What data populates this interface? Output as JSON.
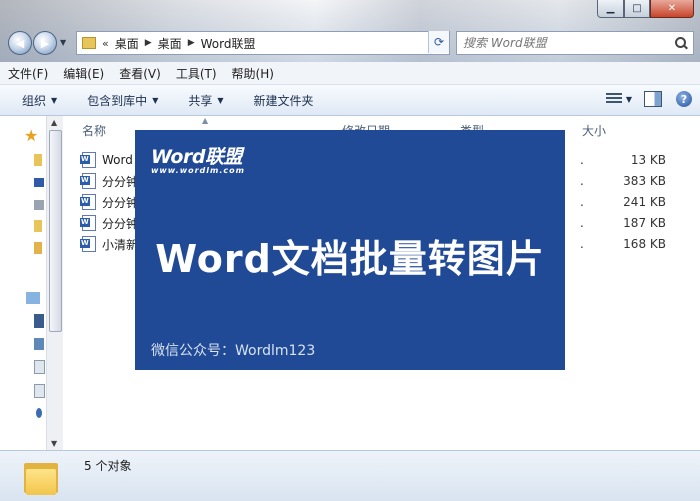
{
  "window": {
    "controls": {
      "minimize": "▁",
      "maximize": "□",
      "close": "✕"
    }
  },
  "nav": {
    "history_arrow": "▼",
    "breadcrumb": [
      "«",
      "桌面",
      "桌面",
      "Word联盟"
    ],
    "search_placeholder": "搜索 Word联盟"
  },
  "menubar": [
    "文件(F)",
    "编辑(E)",
    "查看(V)",
    "工具(T)",
    "帮助(H)"
  ],
  "toolbar": {
    "organize": "组织",
    "include_in_library": "包含到库中",
    "share": "共享",
    "new_folder": "新建文件夹"
  },
  "columns": {
    "name": "名称",
    "modified": "修改日期",
    "type": "类型",
    "size": "大小"
  },
  "files": [
    {
      "name": "Word",
      "size": "13 KB"
    },
    {
      "name": "分分钟",
      "size": "383 KB"
    },
    {
      "name": "分分钟",
      "size": "241 KB"
    },
    {
      "name": "分分钟",
      "size": "187 KB"
    },
    {
      "name": "小清新",
      "size": "168 KB"
    }
  ],
  "status": {
    "count_text": "5 个对象"
  },
  "banner": {
    "logo": "Word联盟",
    "url": "www.wordlm.com",
    "title": "Word文档批量转图片",
    "footer": "微信公众号：Wordlm123",
    "background": "#204a96"
  },
  "icons": {
    "back": "back-arrow-icon",
    "forward": "forward-arrow-icon",
    "refresh": "refresh-icon",
    "search": "search-icon",
    "help": "help-icon",
    "favorites": "star-icon",
    "document": "word-document-icon",
    "folder": "folder-icon"
  }
}
